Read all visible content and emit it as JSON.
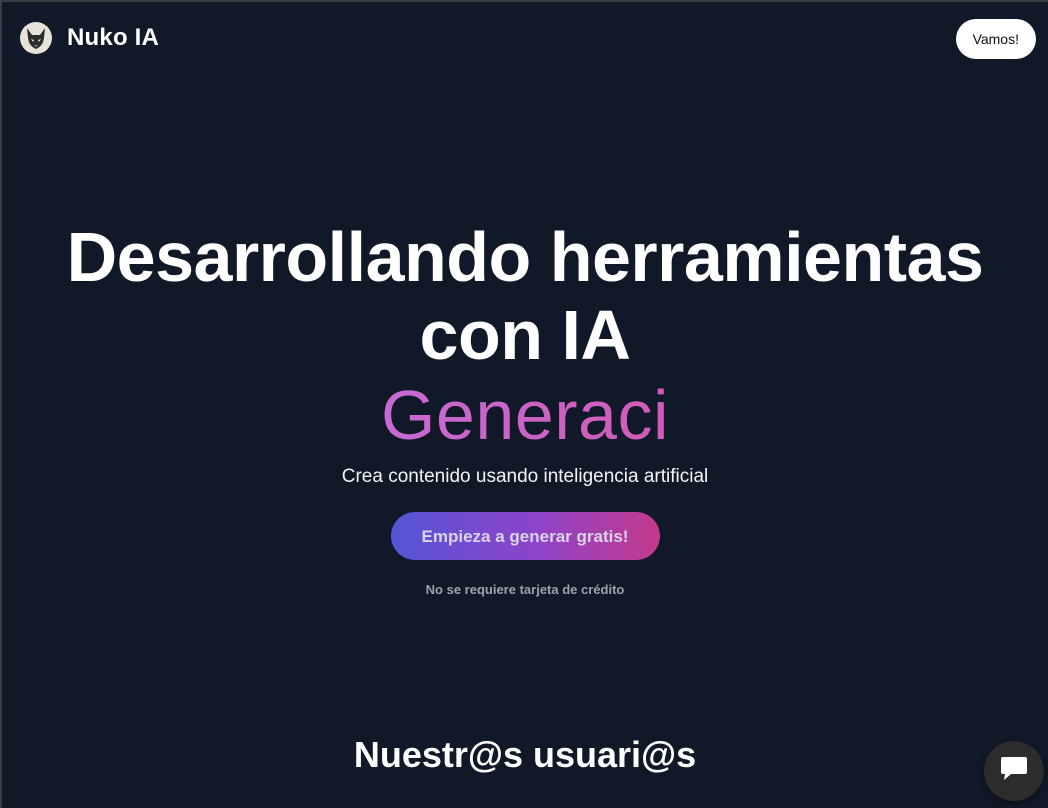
{
  "navbar": {
    "brand_name": "Nuko IA",
    "logo_icon": "fox-logo-icon",
    "cta_label": "Vamos!"
  },
  "hero": {
    "title": "Desarrollando herramientas con IA",
    "typed_text": "Generaci",
    "subtitle": "Crea contenido usando inteligencia artificial",
    "cta_label": "Empieza a generar gratis!",
    "note": "No se requiere tarjeta de crédito"
  },
  "users_section": {
    "heading": "Nuestr@s usuari@s"
  },
  "chat_widget": {
    "icon": "chat-icon"
  },
  "colors": {
    "background": "#111827",
    "typed_gradient_start": "#c66ad4",
    "typed_gradient_end": "#cf5cb7",
    "cta_gradient_start": "#5455d6",
    "cta_gradient_mid": "#8f43c9",
    "cta_gradient_end": "#c33a8a"
  }
}
